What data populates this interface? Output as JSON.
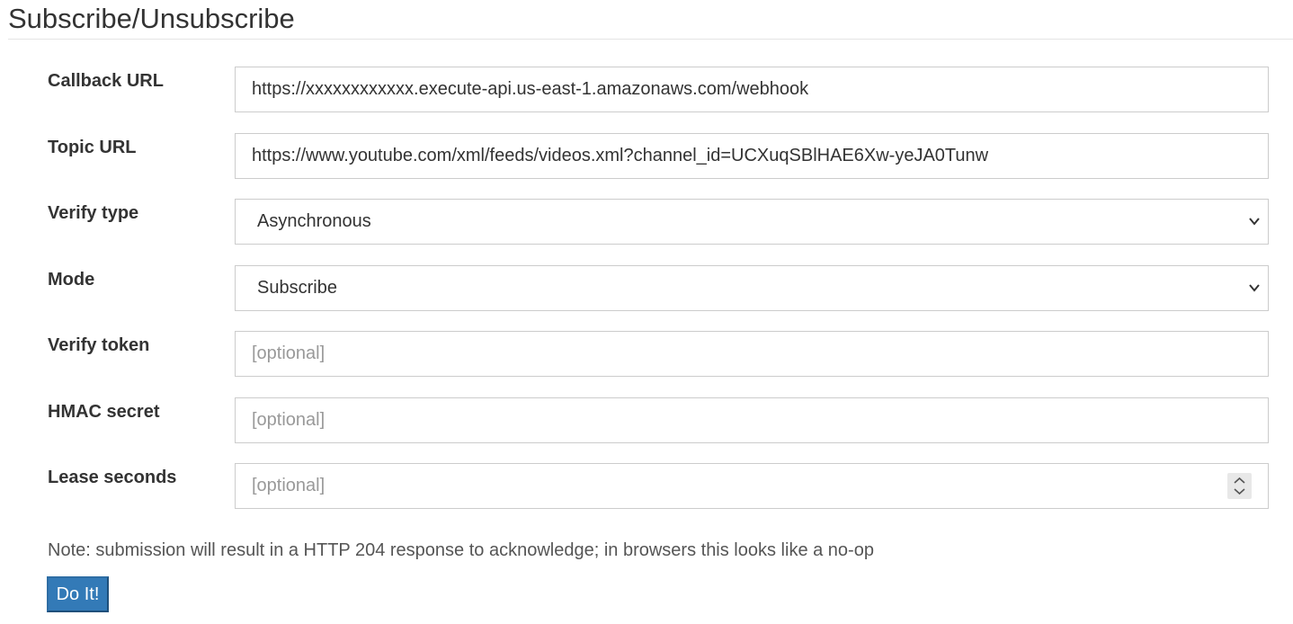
{
  "page": {
    "title": "Subscribe/Unsubscribe"
  },
  "form": {
    "callback_url": {
      "label": "Callback URL",
      "value": "https://xxxxxxxxxxxx.execute-api.us-east-1.amazonaws.com/webhook"
    },
    "topic_url": {
      "label": "Topic URL",
      "value": "https://www.youtube.com/xml/feeds/videos.xml?channel_id=UCXuqSBlHAE6Xw-yeJA0Tunw"
    },
    "verify_type": {
      "label": "Verify type",
      "selected": "Asynchronous",
      "icon": "chevron-down-icon"
    },
    "mode": {
      "label": "Mode",
      "selected": "Subscribe",
      "icon": "chevron-down-icon"
    },
    "verify_token": {
      "label": "Verify token",
      "placeholder": "[optional]"
    },
    "hmac_secret": {
      "label": "HMAC secret",
      "placeholder": "[optional]"
    },
    "lease_seconds": {
      "label": "Lease seconds",
      "placeholder": "[optional]",
      "icon": "spinner-arrows-icon"
    },
    "note": "Note: submission will result in a HTTP 204 response to acknowledge; in browsers this looks like a no-op",
    "submit_label": "Do It!"
  },
  "colors": {
    "button_bg": "#337ab7",
    "button_text": "#ffffff",
    "border": "#cccccc",
    "placeholder": "#999999",
    "text": "#333333"
  }
}
